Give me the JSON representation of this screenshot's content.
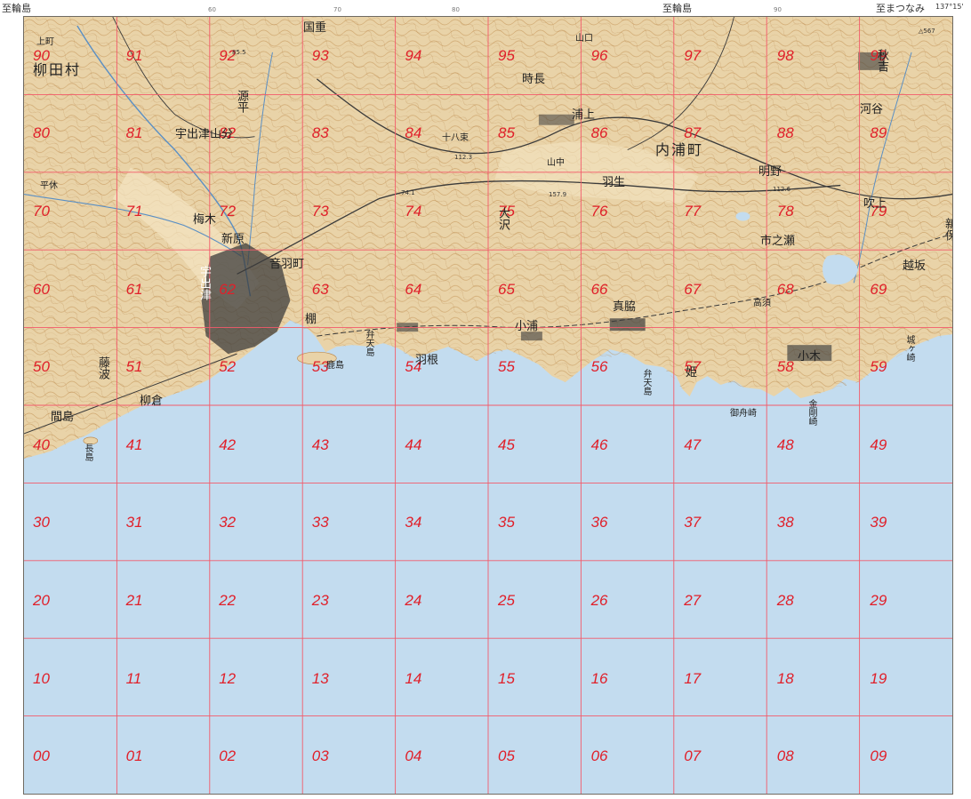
{
  "map": {
    "colors": {
      "land": "#e9d3a8",
      "sea": "#c3dcef",
      "grid": "#f35a6a",
      "grid_label": "#e0202a",
      "contour": "#b87f3c",
      "settlement": "#3c3c3c"
    },
    "edge_labels": {
      "top_left": "至輪島",
      "top_center": "至輪島",
      "top_right": "至まつなみ",
      "longitude": "137°15'",
      "benchmark": "△567"
    },
    "edge_ticks": [
      "60",
      "70",
      "80",
      "90"
    ],
    "grid": {
      "rows": [
        [
          "90",
          "91",
          "92",
          "93",
          "94",
          "95",
          "96",
          "97",
          "98",
          "99"
        ],
        [
          "80",
          "81",
          "82",
          "83",
          "84",
          "85",
          "86",
          "87",
          "88",
          "89"
        ],
        [
          "70",
          "71",
          "72",
          "73",
          "74",
          "75",
          "76",
          "77",
          "78",
          "79"
        ],
        [
          "60",
          "61",
          "62",
          "63",
          "64",
          "65",
          "66",
          "67",
          "68",
          "69"
        ],
        [
          "50",
          "51",
          "52",
          "53",
          "54",
          "55",
          "56",
          "57",
          "58",
          "59"
        ],
        [
          "40",
          "41",
          "42",
          "43",
          "44",
          "45",
          "46",
          "47",
          "48",
          "49"
        ],
        [
          "30",
          "31",
          "32",
          "33",
          "34",
          "35",
          "36",
          "37",
          "38",
          "39"
        ],
        [
          "20",
          "21",
          "22",
          "23",
          "24",
          "25",
          "26",
          "27",
          "28",
          "29"
        ],
        [
          "10",
          "11",
          "12",
          "13",
          "14",
          "15",
          "16",
          "17",
          "18",
          "19"
        ],
        [
          "00",
          "01",
          "02",
          "03",
          "04",
          "05",
          "06",
          "07",
          "08",
          "09"
        ]
      ]
    },
    "places": {
      "yanagida_mura": "柳田村",
      "kamimachi": "上町",
      "kunishige": "国重",
      "minamotodaira": "源平",
      "tokinaga": "時長",
      "yamaguchi": "山口",
      "akimiya": "秋吉",
      "ushitsu_yamabun": "宇出津山分",
      "juhachi": "十八束",
      "urakami": "浦上",
      "uchiura_machi": "内浦町",
      "asano": "明野",
      "kawaya": "河谷",
      "yamanaka": "山中",
      "hanyu": "羽生",
      "fukiage": "吹上",
      "hirakyu": "平休",
      "umeki": "梅木",
      "shinbara": "新原",
      "osawa": "大沢",
      "ichinose": "市之瀬",
      "shinbo": "新保",
      "ushitsu": "宇出津",
      "otowa_machi": "音羽町",
      "koshisaka": "越坂",
      "tohomachi": "棚",
      "benten": "弁天島",
      "tsubajima": "鹿島",
      "hane": "羽根",
      "koura": "小浦",
      "sadawaki": "真脇",
      "takasu": "高須",
      "ogi": "小木",
      "kushihama": "姫",
      "bentenjima2": "弁天島",
      "onzaki": "御舟崎",
      "kongouzaki": "金剛崎",
      "shirogazaki": "城ヶ崎",
      "fujinami": "藤波",
      "yanagura": "柳倉",
      "mamajima": "間島",
      "nagashima": "長島"
    },
    "spot_heights": [
      "85.5",
      "112.3",
      "74.1",
      "157.9",
      "112.6"
    ]
  }
}
